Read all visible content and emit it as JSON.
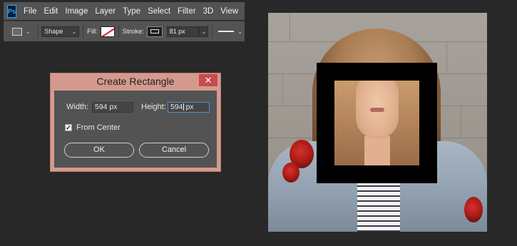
{
  "app": {
    "logo": "Ps"
  },
  "menubar": {
    "items": [
      "File",
      "Edit",
      "Image",
      "Layer",
      "Type",
      "Select",
      "Filter",
      "3D",
      "View"
    ]
  },
  "options": {
    "tool_icon": "rectangle-tool-icon",
    "mode": "Shape",
    "fill_label": "Fill:",
    "fill_color": "none",
    "stroke_label": "Stroke:",
    "stroke_color": "#000000",
    "stroke_width": "81 px",
    "stroke_style": "solid"
  },
  "dialog": {
    "title": "Create Rectangle",
    "close_label": "✕",
    "width_label": "Width:",
    "width_value": "594 px",
    "height_label": "Height:",
    "height_value_before_caret": "594",
    "height_value_after_caret": " px",
    "from_center_label": "From Center",
    "from_center_checked": true,
    "ok_label": "OK",
    "cancel_label": "Cancel",
    "title_bar_color": "#d49a8d"
  },
  "canvas": {
    "frame_color": "#000000"
  }
}
